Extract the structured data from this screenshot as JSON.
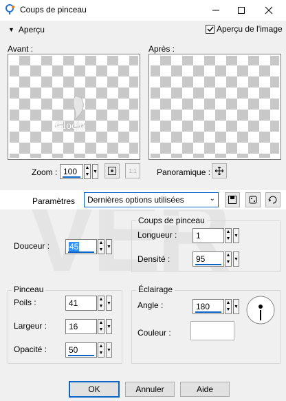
{
  "window": {
    "title": "Coups de pinceau"
  },
  "preview_toggle": {
    "label": "Aperçu"
  },
  "image_preview": {
    "label": "Aperçu de l'image",
    "checked": true
  },
  "before": {
    "label": "Avant :",
    "watermark": "Cloclo"
  },
  "after": {
    "label": "Après :"
  },
  "zoom": {
    "label": "Zoom :",
    "value": "100"
  },
  "pan": {
    "label": "Panoramique :"
  },
  "params": {
    "label": "Paramètres",
    "selected": "Dernières options utilisées"
  },
  "softness": {
    "label": "Douceur :",
    "value": "45"
  },
  "strokes": {
    "title": "Coups de pinceau",
    "length_label": "Longueur :",
    "length_value": "1",
    "density_label": "Densité :",
    "density_value": "95"
  },
  "brush": {
    "title": "Pinceau",
    "bristles_label": "Poils :",
    "bristles_value": "41",
    "width_label": "Largeur :",
    "width_value": "16",
    "opacity_label": "Opacité :",
    "opacity_value": "50"
  },
  "lighting": {
    "title": "Éclairage",
    "angle_label": "Angle :",
    "angle_value": "180",
    "color_label": "Couleur :",
    "color": "#ffffff"
  },
  "buttons": {
    "ok": "OK",
    "cancel": "Annuler",
    "help": "Aide"
  },
  "colors": {
    "accent": "#0a64c8",
    "panel": "#f0f0f0",
    "title_bg": "#ffffff"
  }
}
